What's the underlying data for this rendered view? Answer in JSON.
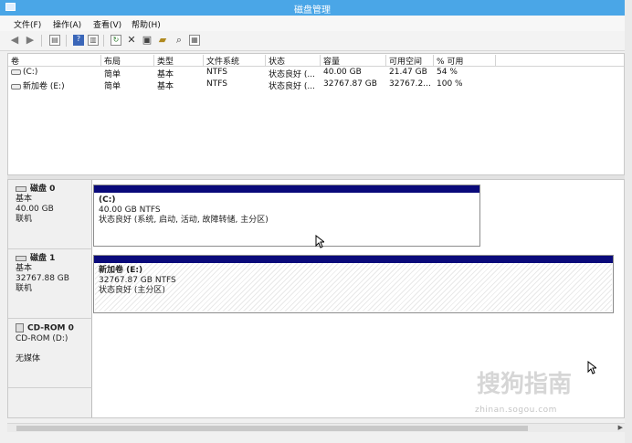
{
  "window": {
    "title": "磁盘管理"
  },
  "menu": [
    "文件(F)",
    "操作(A)",
    "查看(V)",
    "帮助(H)"
  ],
  "toolbar": {
    "icons": [
      "back-arrow-icon",
      "forward-arrow-icon",
      "properties-icon",
      "help-icon",
      "show-pane-icon",
      "refresh-icon",
      "delete-icon",
      "connect-icon",
      "open-folder-icon",
      "search-icon",
      "format-icon"
    ]
  },
  "volume_list": {
    "columns": [
      "卷",
      "布局",
      "类型",
      "文件系统",
      "状态",
      "容量",
      "可用空间",
      "% 可用"
    ],
    "rows": [
      [
        "(C:)",
        "简单",
        "基本",
        "NTFS",
        "状态良好 (...",
        "40.00 GB",
        "21.47 GB",
        "54 %"
      ],
      [
        "新加卷 (E:)",
        "简单",
        "基本",
        "NTFS",
        "状态良好 (...",
        "32767.87 GB",
        "32767.2...",
        "100 %"
      ]
    ]
  },
  "disks": [
    {
      "name": "磁盘 0",
      "type": "基本",
      "size": "40.00 GB",
      "status": "联机",
      "partition": {
        "name": "(C:)",
        "size_fs": "40.00 GB NTFS",
        "status": "状态良好 (系统, 启动, 活动, 故障转储, 主分区)"
      }
    },
    {
      "name": "磁盘 1",
      "type": "基本",
      "size": "32767.88 GB",
      "status": "联机",
      "partition": {
        "name": "新加卷 (E:)",
        "size_fs": "32767.87 GB NTFS",
        "status": "状态良好 (主分区)"
      }
    }
  ],
  "cdrom": {
    "name": "CD-ROM 0",
    "drive": "CD-ROM (D:)",
    "media": "无媒体"
  },
  "watermark": {
    "text_cn": "搜狗指南",
    "url": "zhinan.sogou.com"
  },
  "colors": {
    "titlebar": "#4aa6e7",
    "partition_bar": "#0a0a7a"
  }
}
